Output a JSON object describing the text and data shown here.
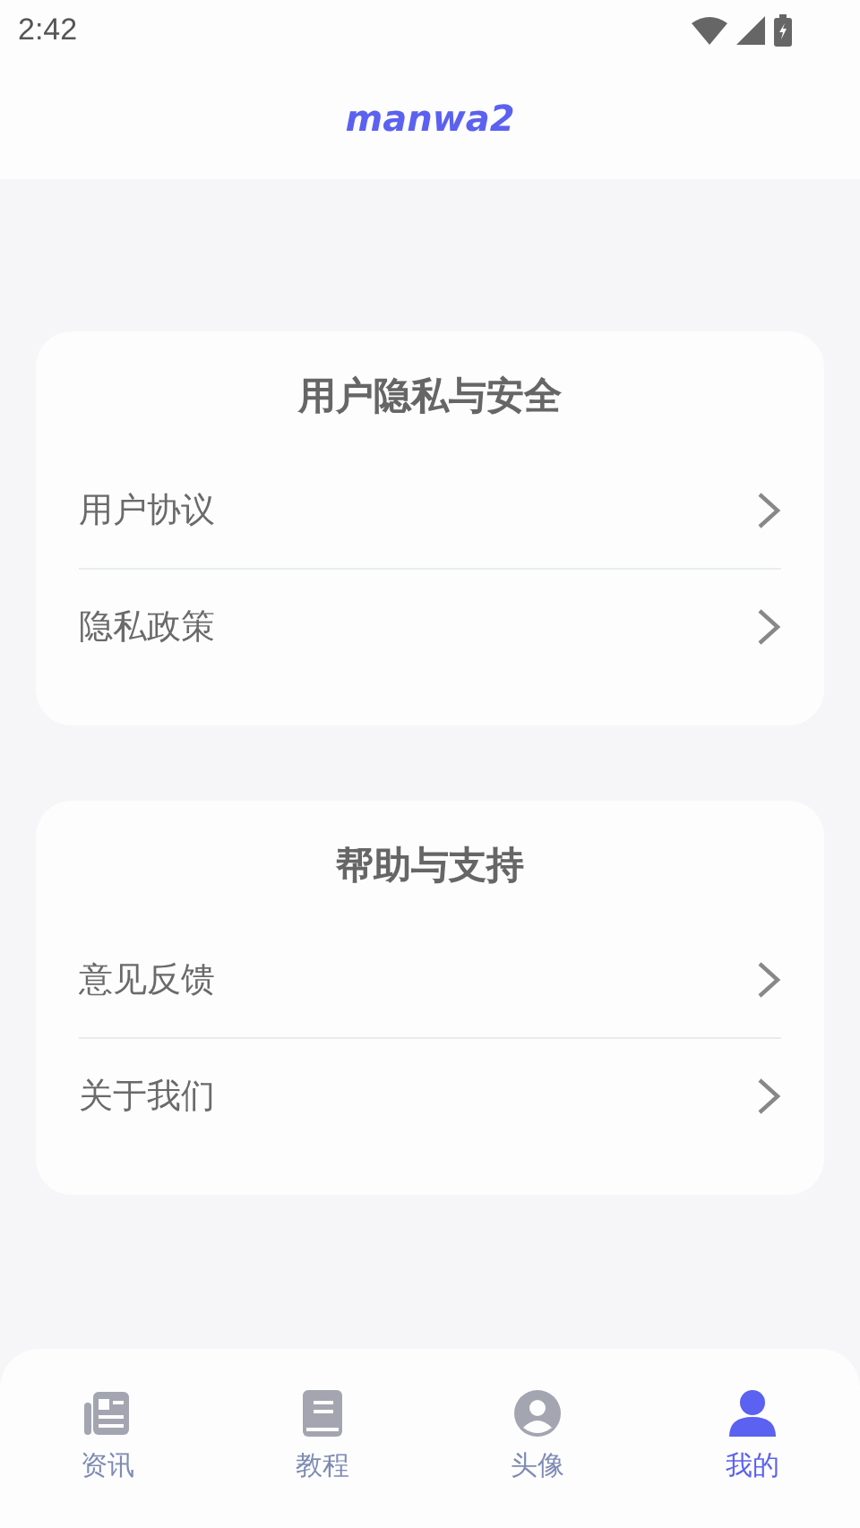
{
  "status_bar": {
    "time": "2:42"
  },
  "header": {
    "logo": "manwa2"
  },
  "sections": [
    {
      "title": "用户隐私与安全",
      "items": [
        {
          "label": "用户协议"
        },
        {
          "label": "隐私政策"
        }
      ]
    },
    {
      "title": "帮助与支持",
      "items": [
        {
          "label": "意见反馈"
        },
        {
          "label": "关于我们"
        }
      ]
    }
  ],
  "tabs": [
    {
      "label": "资讯",
      "kind": "news",
      "selected": false
    },
    {
      "label": "教程",
      "kind": "book",
      "selected": false
    },
    {
      "label": "头像",
      "kind": "avatar",
      "selected": false
    },
    {
      "label": "我的",
      "kind": "person",
      "selected": true
    }
  ]
}
